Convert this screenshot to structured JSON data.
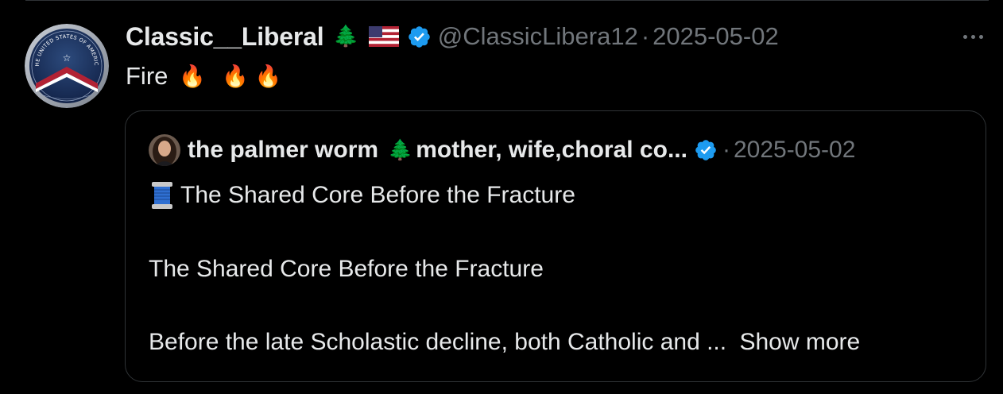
{
  "post": {
    "display_name": "Classic__Liberal",
    "name_emojis": [
      "🌲",
      "🇺🇸"
    ],
    "handle": "@ClassicLibera12",
    "separator": "·",
    "date": "2025-05-02",
    "text": "Fire",
    "text_emojis": [
      "🔥",
      "🔥",
      "🔥"
    ],
    "avatar_seal_text": "THE UNITED STATES OF AMERICA"
  },
  "quote": {
    "display_name": "the palmer worm",
    "tree_emoji": "🌲",
    "bio_name": "mother, wife,choral co...",
    "separator": "·",
    "date": "2025-05-02",
    "title_emoji": "🧵",
    "title": "The Shared Core Before the Fracture",
    "paragraph_1": "The Shared Core Before the Fracture",
    "paragraph_2": "Before the late Scholastic decline, both Catholic and ...",
    "show_more": "Show more"
  },
  "colors": {
    "background": "#000000",
    "text_primary": "#e7e9ea",
    "text_secondary": "#71767b",
    "border": "#2f3336",
    "verified_blue": "#1d9bf0"
  },
  "icons": [
    "verified-badge-icon",
    "more-options-icon"
  ]
}
